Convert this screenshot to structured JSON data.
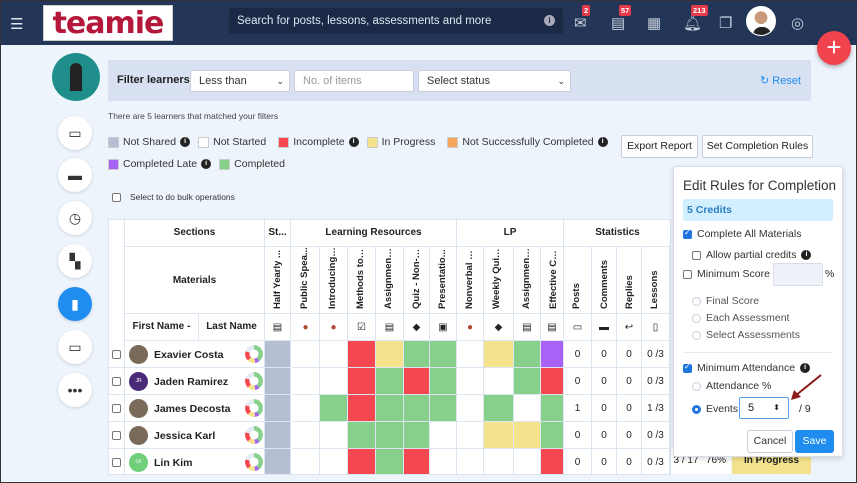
{
  "topbar": {
    "logo": "teamie",
    "search_placeholder": "Search for posts, lessons, assessments and more",
    "badges": {
      "messages": "2",
      "posts": "57",
      "notifications": "213"
    }
  },
  "filter": {
    "label": "Filter learners",
    "comparator": "Less than",
    "items_placeholder": "No. of items",
    "status": "Select status",
    "reset": "Reset"
  },
  "matched_text": "There are 5 learners that matched your filters",
  "legend": [
    {
      "label": "Not Shared",
      "color": "#b4bfd4",
      "info": true
    },
    {
      "label": "Not Started",
      "color": "#ffffff",
      "info": false
    },
    {
      "label": "Incomplete",
      "color": "#f5474f",
      "info": true
    },
    {
      "label": "In Progress",
      "color": "#f4e38c",
      "info": false
    },
    {
      "label": "Not Successfully Completed",
      "color": "#f4a55a",
      "info": true
    },
    {
      "label": "Completed Late",
      "color": "#a862f5",
      "info": true
    },
    {
      "label": "Completed",
      "color": "#87d08c",
      "info": false
    }
  ],
  "buttons": {
    "export": "Export Report",
    "completion_rules": "Set Completion Rules"
  },
  "bulk_label": "Select to do bulk operations",
  "table": {
    "sections_label": "Sections",
    "materials_label": "Materials",
    "first_name": "First Name",
    "sort_indicator": "-",
    "last_name": "Last Name",
    "sections": [
      "St...",
      "Learning Resources",
      "LP",
      "Statistics"
    ],
    "materials": [
      "Half Yearly ...",
      "Public Spea...",
      "Introducing ...",
      "Methods to i...",
      "Assignment ...",
      "Quiz - Non-v...",
      "Presentatio...",
      "Nonverbal C...",
      "Weekly Quiz...",
      "Assignment ...",
      "Effective Co..."
    ],
    "stat_columns": [
      "Posts",
      "Comments",
      "Replies",
      "Lessons"
    ],
    "rows": [
      {
        "name": "Exavier Costa",
        "cells": [
          "grey",
          "w",
          "w",
          "red",
          "yel",
          "grn",
          "grn",
          "w",
          "yel",
          "grn",
          "pur"
        ],
        "stats": [
          "0",
          "0",
          "0",
          "0 /3"
        ]
      },
      {
        "name": "Jaden Ramirez",
        "initials": "JR",
        "cells": [
          "grey",
          "w",
          "w",
          "red",
          "grn",
          "red",
          "grn",
          "w",
          "w",
          "grn",
          "red"
        ],
        "stats": [
          "0",
          "0",
          "0",
          "0 /3"
        ]
      },
      {
        "name": "James Decosta",
        "cells": [
          "grey",
          "w",
          "grn",
          "red",
          "grn",
          "grn",
          "grn",
          "w",
          "grn",
          "w",
          "grn"
        ],
        "stats": [
          "1",
          "0",
          "0",
          "1 /3"
        ]
      },
      {
        "name": "Jessica Karl",
        "cells": [
          "grey",
          "w",
          "w",
          "grn",
          "grn",
          "grn",
          "w",
          "w",
          "yel",
          "yel",
          "grn"
        ],
        "stats": [
          "0",
          "0",
          "0",
          "0 /3"
        ]
      },
      {
        "name": "Lin Kim",
        "initials": "LK",
        "cells": [
          "grey",
          "w",
          "w",
          "red",
          "grn",
          "red",
          "w",
          "w",
          "w",
          "w",
          "red"
        ],
        "stats": [
          "0",
          "0",
          "0",
          "0 /3"
        ]
      }
    ],
    "last_row_extra": {
      "events": "3 / 17",
      "percent": "76%",
      "status": "In Progress"
    }
  },
  "cell_colors": {
    "grey": "#b4bfd4",
    "w": "#ffffff",
    "red": "#f5474f",
    "yel": "#f4e38c",
    "grn": "#87d08c",
    "pur": "#a862f5"
  },
  "popover": {
    "title": "Edit Rules for Completion",
    "credits": "5 Credits",
    "complete_all": "Complete All Materials",
    "partial": "Allow partial credits",
    "min_score": "Minimum Score",
    "percent": "%",
    "final_score": "Final Score",
    "each_assessment": "Each Assessment",
    "select_assessments": "Select Assessments",
    "min_attendance": "Minimum Attendance",
    "attendance_pct": "Attendance %",
    "events": "Events",
    "events_value": "5",
    "events_total": "/ 9",
    "cancel": "Cancel",
    "save": "Save"
  }
}
